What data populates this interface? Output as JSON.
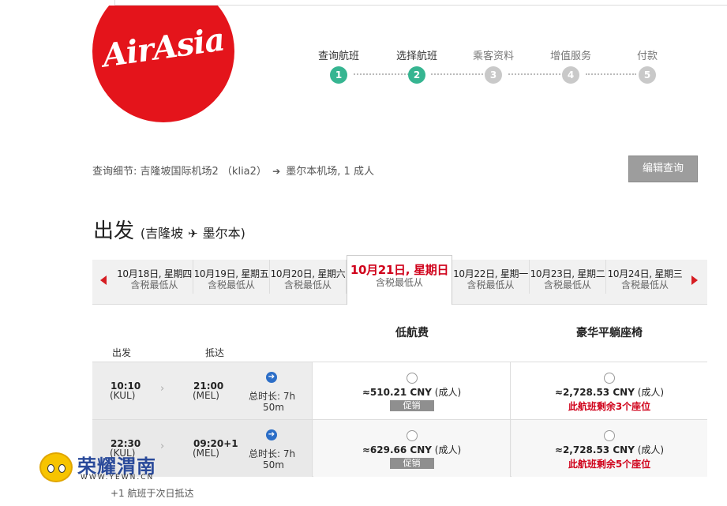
{
  "brand": {
    "name": "AirAsia",
    "color": "#e4141b"
  },
  "steps": [
    {
      "label": "查询航班",
      "number": "1",
      "state": "done"
    },
    {
      "label": "选择航班",
      "number": "2",
      "state": "active"
    },
    {
      "label": "乘客资料",
      "number": "3",
      "state": "pending"
    },
    {
      "label": "增值服务",
      "number": "4",
      "state": "pending"
    },
    {
      "label": "付款",
      "number": "5",
      "state": "pending"
    }
  ],
  "summary": {
    "prefix": "查询细节:",
    "origin": "吉隆坡国际机场2 （klia2）",
    "arrow": "➔",
    "destination": "墨尔本机场, 1 成人"
  },
  "edit_button": "编辑查询",
  "departure": {
    "heading": "出发",
    "route_open": "(吉隆坡",
    "plane": "✈",
    "route_close": "墨尔本)"
  },
  "dates": [
    {
      "date": "10月18日, 星期四",
      "sub": "含税最低从",
      "selected": false
    },
    {
      "date": "10月19日, 星期五",
      "sub": "含税最低从",
      "selected": false
    },
    {
      "date": "10月20日, 星期六",
      "sub": "含税最低从",
      "selected": false
    },
    {
      "date": "10月21日, 星期日",
      "sub": "含税最低从",
      "selected": true
    },
    {
      "date": "10月22日, 星期一",
      "sub": "含税最低从",
      "selected": false
    },
    {
      "date": "10月23日, 星期二",
      "sub": "含税最低从",
      "selected": false
    },
    {
      "date": "10月24日, 星期三",
      "sub": "含税最低从",
      "selected": false
    }
  ],
  "fare_headers": {
    "low": "低航费",
    "premium": "豪华平躺座椅"
  },
  "columns": {
    "depart": "出发",
    "arrive": "抵达"
  },
  "flights": [
    {
      "dep_time": "10:10",
      "dep_code": "(KUL)",
      "arr_time": "21:00",
      "arr_code": "(MEL)",
      "duration_line1": "总时长: 7h",
      "duration_line2": "50m",
      "low_price": "≈510.21 CNY",
      "low_suffix": "(成人)",
      "promo": "促销",
      "premium_price": "≈2,728.53 CNY",
      "premium_suffix": "(成人)",
      "seats_left": "此航班剩余3个座位"
    },
    {
      "dep_time": "22:30",
      "dep_code": "(KUL)",
      "arr_time": "09:20+1",
      "arr_code": "(MEL)",
      "duration_line1": "总时长: 7h",
      "duration_line2": "50m",
      "low_price": "≈629.66 CNY",
      "low_suffix": "(成人)",
      "promo": "促销",
      "premium_price": "≈2,728.53 CNY",
      "premium_suffix": "(成人)",
      "seats_left": "此航班剩余5个座位"
    }
  ],
  "footnote": "+1 航班于次日抵达",
  "watermark": {
    "title": "荣耀渭南",
    "url": "WWW.YEWN.CN"
  }
}
